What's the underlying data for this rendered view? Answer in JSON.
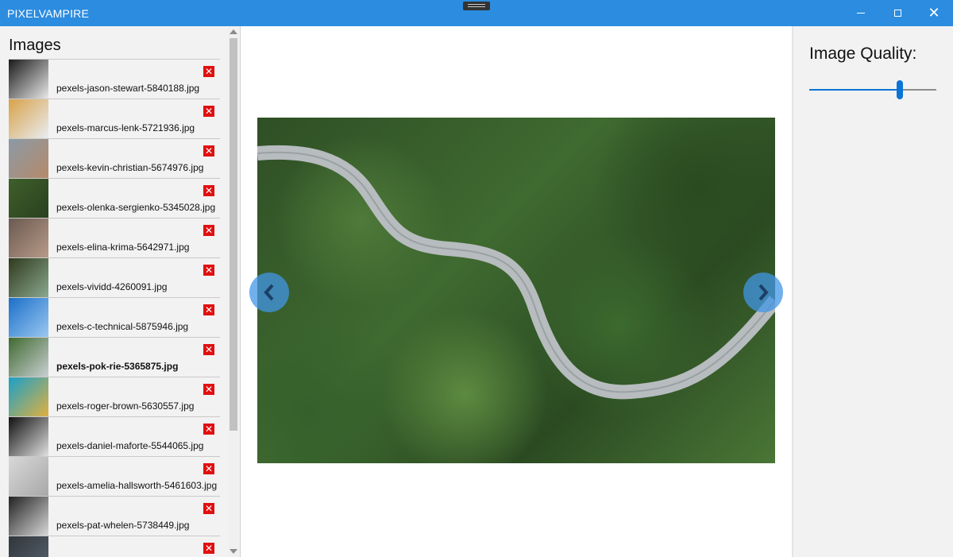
{
  "window": {
    "title": "PIXELVAMPIRE",
    "controls": {
      "minimize": "minimize-icon",
      "maximize": "maximize-icon",
      "close": "close-icon",
      "close_glyph": "✕"
    }
  },
  "sidebar": {
    "title": "Images",
    "delete_glyph": "✕",
    "items": [
      {
        "name": "pexels-jason-stewart-5840188.jpg",
        "selected": false,
        "thumb": [
          "#1a1a1a",
          "#e8e8e8"
        ]
      },
      {
        "name": "pexels-marcus-lenk-5721936.jpg",
        "selected": false,
        "thumb": [
          "#d8a24a",
          "#e9edf2"
        ]
      },
      {
        "name": "pexels-kevin-christian-5674976.jpg",
        "selected": false,
        "thumb": [
          "#8b9aa6",
          "#b58a6a"
        ]
      },
      {
        "name": "pexels-olenka-sergienko-5345028.jpg",
        "selected": false,
        "thumb": [
          "#3e5f2a",
          "#2a4020"
        ]
      },
      {
        "name": "pexels-elina-krima-5642971.jpg",
        "selected": false,
        "thumb": [
          "#6a5a50",
          "#b89a88"
        ]
      },
      {
        "name": "pexels-vividd-4260091.jpg",
        "selected": false,
        "thumb": [
          "#2f3a1c",
          "#8aa890"
        ]
      },
      {
        "name": "pexels-c-technical-5875946.jpg",
        "selected": false,
        "thumb": [
          "#1b6fc9",
          "#9bc8f0"
        ]
      },
      {
        "name": "pexels-pok-rie-5365875.jpg",
        "selected": true,
        "thumb": [
          "#3f6a30",
          "#c9cfd2"
        ]
      },
      {
        "name": "pexels-roger-brown-5630557.jpg",
        "selected": false,
        "thumb": [
          "#1aa0c8",
          "#e0b040"
        ]
      },
      {
        "name": "pexels-daniel-maforte-5544065.jpg",
        "selected": false,
        "thumb": [
          "#111111",
          "#e0e0e0"
        ]
      },
      {
        "name": "pexels-amelia-hallsworth-5461603.jpg",
        "selected": false,
        "thumb": [
          "#d8d8d8",
          "#a8a8a8"
        ]
      },
      {
        "name": "pexels-pat-whelen-5738449.jpg",
        "selected": false,
        "thumb": [
          "#222222",
          "#d8d8d8"
        ]
      },
      {
        "name": "",
        "selected": false,
        "thumb": [
          "#30363c",
          "#5a6470"
        ]
      }
    ]
  },
  "viewer": {
    "image_alt": "Aerial view of winding road through forest",
    "prev_icon": "chevron-left-icon",
    "next_icon": "chevron-right-icon"
  },
  "panel": {
    "quality_label": "Image Quality:",
    "quality_value": 0.69,
    "accent": "#0a74d6"
  }
}
